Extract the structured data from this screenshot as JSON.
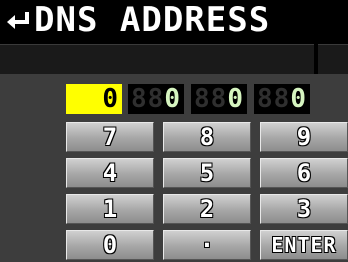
{
  "header": {
    "title": "DNS ADDRESS",
    "back_icon": "return-arrow-icon"
  },
  "address": {
    "octets": [
      {
        "ghost": "88",
        "value": "0"
      },
      {
        "ghost": "88",
        "value": "0"
      },
      {
        "ghost": "88",
        "value": "0"
      },
      {
        "ghost": "88",
        "value": "0"
      }
    ],
    "active_octet_index": 0
  },
  "keypad": {
    "rows": [
      [
        "7",
        "8",
        "9"
      ],
      [
        "4",
        "5",
        "6"
      ],
      [
        "1",
        "2",
        "3"
      ],
      [
        "0",
        "·",
        "ENTER"
      ]
    ]
  },
  "colors": {
    "active_field": "#ffff00",
    "panel": "#3d3d3d",
    "segment_on": "#d6f5c0"
  }
}
